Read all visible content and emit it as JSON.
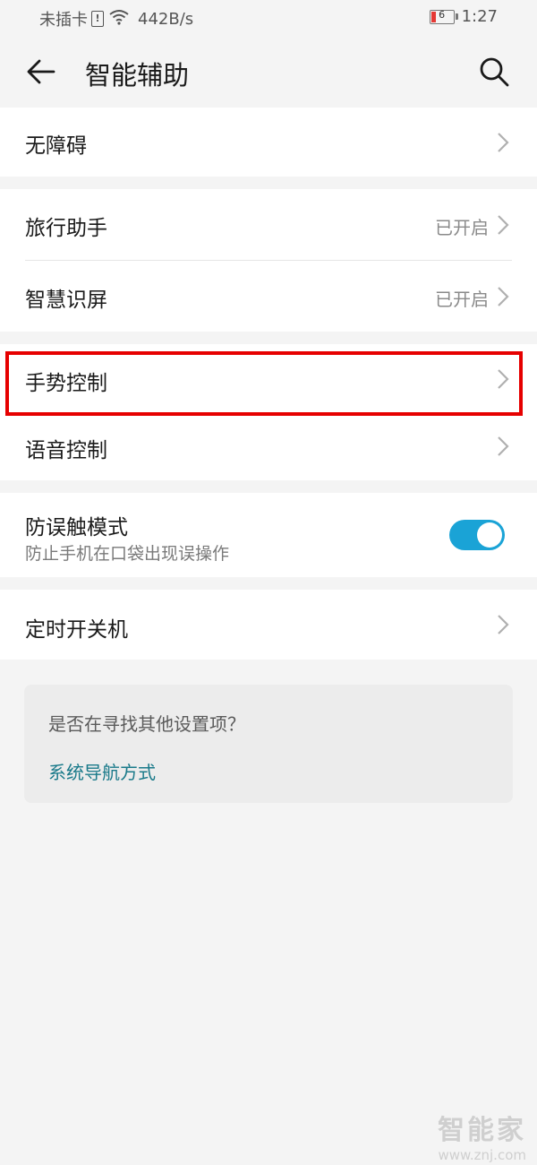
{
  "status_bar": {
    "carrier": "未插卡",
    "sim_badge": "!",
    "speed": "442B/s",
    "battery_level": "6",
    "time": "1:27"
  },
  "header": {
    "title": "智能辅助",
    "back_icon": "back-arrow-icon",
    "search_icon": "search-icon"
  },
  "settings": {
    "accessibility": {
      "label": "无障碍"
    },
    "travel_assistant": {
      "label": "旅行助手",
      "value": "已开启"
    },
    "smart_screen": {
      "label": "智慧识屏",
      "value": "已开启"
    },
    "gesture_control": {
      "label": "手势控制"
    },
    "voice_control": {
      "label": "语音控制"
    },
    "pocket_mode": {
      "label": "防误触模式",
      "description": "防止手机在口袋出现误操作",
      "enabled": true
    },
    "scheduled_power": {
      "label": "定时开关机"
    }
  },
  "suggestion": {
    "title": "是否在寻找其他设置项？",
    "link": "系统导航方式"
  },
  "watermark": {
    "logo": "智能家",
    "url": "www.znj.com"
  },
  "colors": {
    "accent": "#1aa3d6",
    "highlight": "#e60000",
    "link": "#1a7a8a",
    "battery_low": "#e53935"
  }
}
